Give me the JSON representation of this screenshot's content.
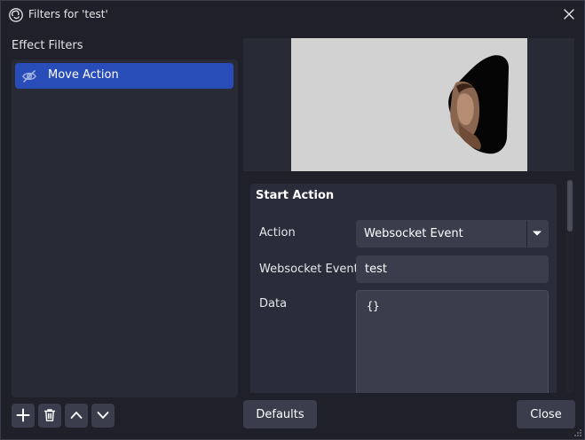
{
  "window": {
    "title": "Filters for 'test'",
    "icons": {
      "app": "obs-logo-icon",
      "close": "close-icon"
    }
  },
  "effect_filters": {
    "heading": "Effect Filters",
    "items": [
      {
        "label": "Move Action",
        "selected": true,
        "visibility_icon": "eye-hidden-icon"
      }
    ],
    "toolbar": [
      {
        "icon": "plus-icon",
        "action": "add"
      },
      {
        "icon": "trash-icon",
        "action": "remove"
      },
      {
        "icon": "chevron-up-icon",
        "action": "move-up"
      },
      {
        "icon": "chevron-down-icon",
        "action": "move-down"
      }
    ]
  },
  "properties": {
    "section_title": "Start Action",
    "action": {
      "label": "Action",
      "value": "Websocket Event"
    },
    "websocket_event": {
      "label": "Websocket Event",
      "value": "test"
    },
    "data": {
      "label": "Data",
      "value": "{}"
    }
  },
  "buttons": {
    "defaults": "Defaults",
    "close": "Close"
  },
  "colors": {
    "selection": "#284cb8",
    "background": "#1f2029",
    "panel": "#282a35",
    "control": "#3b3d4c",
    "preview_canvas": "#d2d2d2"
  }
}
